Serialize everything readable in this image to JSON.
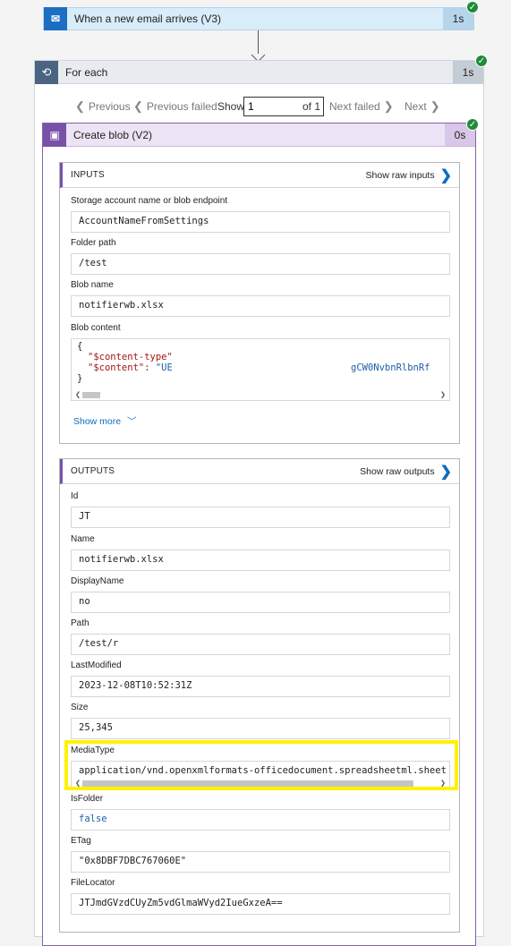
{
  "trigger": {
    "title": "When a new email arrives (V3)",
    "duration": "1s",
    "icon": "outlook-icon"
  },
  "foreach": {
    "title": "For each",
    "duration": "1s",
    "icon": "loop-icon",
    "pager": {
      "previous": "Previous",
      "previous_failed": "Previous failed",
      "show": "Show",
      "current": "1",
      "of": "of 1",
      "next_failed": "Next failed",
      "next": "Next"
    }
  },
  "action": {
    "title": "Create blob (V2)",
    "duration": "0s",
    "icon": "blob-storage-icon"
  },
  "inputs": {
    "header": "INPUTS",
    "raw_label": "Show raw inputs",
    "fields": {
      "storage": {
        "label": "Storage account name or blob endpoint",
        "value": "AccountNameFromSettings"
      },
      "folder": {
        "label": "Folder path",
        "value": "/test"
      },
      "blobname": {
        "label": "Blob name",
        "value": "notifierwb.xlsx"
      },
      "content": {
        "label": "Blob content",
        "line1": "{",
        "line2_key": "\"$content-type\"",
        "line3_key": "\"$content\": ",
        "line3_val": "\"UE",
        "line3_tail": "gCW0NvbnRlbnRf",
        "line4": "}"
      }
    },
    "show_more": "Show more"
  },
  "outputs": {
    "header": "OUTPUTS",
    "raw_label": "Show raw outputs",
    "fields": {
      "id": {
        "label": "Id",
        "value": "JT"
      },
      "name": {
        "label": "Name",
        "value": "notifierwb.xlsx"
      },
      "displayname": {
        "label": "DisplayName",
        "value": "no"
      },
      "path": {
        "label": "Path",
        "value": "/test/r"
      },
      "lastmodified": {
        "label": "LastModified",
        "value": "2023-12-08T10:52:31Z"
      },
      "size": {
        "label": "Size",
        "value": "25,345"
      },
      "mediatype": {
        "label": "MediaType",
        "value": "application/vnd.openxmlformats-officedocument.spreadsheetml.sheet"
      },
      "isfolder": {
        "label": "IsFolder",
        "value": "false"
      },
      "etag": {
        "label": "ETag",
        "value": "\"0x8DBF7DBC767060E\""
      },
      "filelocator": {
        "label": "FileLocator",
        "value": "JTJmdGVzdCUyZm5vdGlmaWVyd2IueGxzeA=="
      }
    }
  },
  "colors": {
    "success": "#1e8b3a",
    "highlight": "#fff200",
    "action_accent": "#7851a9",
    "link": "#0f6cbd"
  }
}
